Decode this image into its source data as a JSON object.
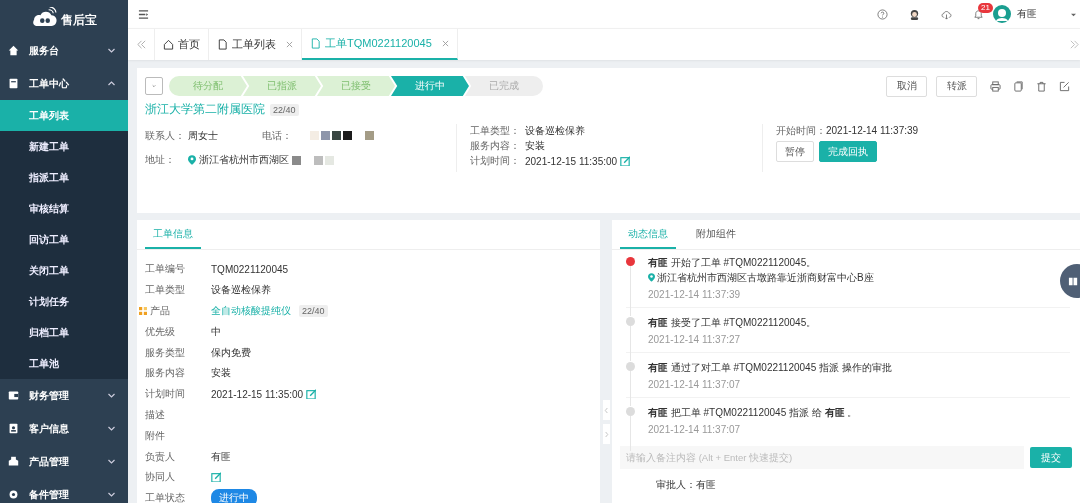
{
  "app": {
    "logo_text": "售后宝"
  },
  "sidebar": {
    "items": [
      {
        "label": "服务台",
        "expanded": false
      },
      {
        "label": "工单中心",
        "expanded": true,
        "children": [
          {
            "label": "工单列表",
            "selected": true
          },
          {
            "label": "新建工单",
            "selected": false
          },
          {
            "label": "指派工单",
            "selected": false
          },
          {
            "label": "审核结算",
            "selected": false
          },
          {
            "label": "回访工单",
            "selected": false
          },
          {
            "label": "关闭工单",
            "selected": false
          },
          {
            "label": "计划任务",
            "selected": false
          },
          {
            "label": "归档工单",
            "selected": false
          },
          {
            "label": "工单池",
            "selected": false
          }
        ]
      },
      {
        "label": "财务管理",
        "expanded": false
      },
      {
        "label": "客户信息",
        "expanded": false
      },
      {
        "label": "产品管理",
        "expanded": false
      },
      {
        "label": "备件管理",
        "expanded": false
      }
    ]
  },
  "header": {
    "notification_count": "21",
    "user_name": "有匪"
  },
  "tabs": [
    {
      "label": "首页",
      "closable": false,
      "selected": false
    },
    {
      "label": "工单列表",
      "closable": true,
      "selected": false
    },
    {
      "label": "工单TQM0221120045",
      "closable": true,
      "selected": true
    }
  ],
  "order": {
    "stages": [
      {
        "label": "待分配",
        "completed": true,
        "selected": false
      },
      {
        "label": "已指派",
        "completed": true,
        "selected": false
      },
      {
        "label": "已接受",
        "completed": true,
        "selected": false
      },
      {
        "label": "进行中",
        "completed": false,
        "selected": true
      },
      {
        "label": "已完成",
        "completed": false,
        "selected": false
      }
    ],
    "buttons": [
      "取消",
      "转派"
    ],
    "customer": "浙江大学第二附属医院",
    "customer_badge": "22/40",
    "contact_label": "联系人：",
    "contact": "周女士",
    "phone_label": "电话：",
    "address_label": "地址：",
    "address": "浙江省杭州市西湖区",
    "details": [
      {
        "label": "工单类型：",
        "value": "设备巡检保养"
      },
      {
        "label": "服务内容：",
        "value": "安装"
      },
      {
        "label": "计划时间：",
        "value": "2021-12-15 11:35:00",
        "editable": true
      }
    ],
    "start_label": "开始时间：",
    "start_time": "2021-12-14 11:37:39",
    "actions": [
      {
        "label": "暂停",
        "primary": false
      },
      {
        "label": "完成回执",
        "primary": true
      }
    ]
  },
  "info": {
    "tabs": [
      {
        "label": "工单信息",
        "selected": true
      }
    ],
    "fields": [
      {
        "label": "工单编号",
        "value": "TQM0221120045",
        "kind": "text"
      },
      {
        "label": "工单类型",
        "value": "设备巡检保养",
        "kind": "text"
      },
      {
        "label": "产品",
        "value": "全自动核酸提纯仪",
        "kind": "link",
        "badge": "22/40"
      },
      {
        "label": "优先级",
        "value": "中",
        "kind": "text"
      },
      {
        "label": "服务类型",
        "value": "保内免费",
        "kind": "text"
      },
      {
        "label": "服务内容",
        "value": "安装",
        "kind": "text"
      },
      {
        "label": "计划时间",
        "value": "2021-12-15 11:35:00",
        "kind": "text",
        "editable": true
      },
      {
        "label": "描述",
        "kind": "text"
      },
      {
        "label": "附件",
        "kind": "text"
      },
      {
        "label": "负责人",
        "value": "有匪",
        "kind": "text"
      },
      {
        "label": "协同人",
        "kind": "text",
        "editable": true
      },
      {
        "label": "工单状态",
        "value": "进行中",
        "kind": "status"
      }
    ]
  },
  "activity": {
    "tabs": [
      {
        "label": "动态信息",
        "selected": true
      },
      {
        "label": "附加组件",
        "selected": false
      }
    ],
    "events": [
      {
        "text": "**有匪** 开始了工单 #TQM0221120045。",
        "location": "浙江省杭州市西湖区古墩路靠近浙商财富中心B座",
        "time": "2021-12-14 11:37:39",
        "color": "#e8363c"
      },
      {
        "text": "**有匪** 接受了工单 #TQM0221120045。",
        "time": "2021-12-14 11:37:27",
        "color": "#dcdcdc"
      },
      {
        "text": "**有匪** 通过了对工单 #TQM0221120045 指派 操作的审批",
        "time": "2021-12-14 11:37:07",
        "color": "#dcdcdc"
      },
      {
        "text": "**有匪** 把工单 #TQM0221120045 指派 给 **有匪** 。",
        "time": "2021-12-14 11:37:07",
        "color": "#dcdcdc"
      }
    ],
    "comment_placeholder": "请输入备注内容 (Alt + Enter 快速提交)",
    "submit": "提交",
    "footer_note": "审批人：有匪"
  }
}
